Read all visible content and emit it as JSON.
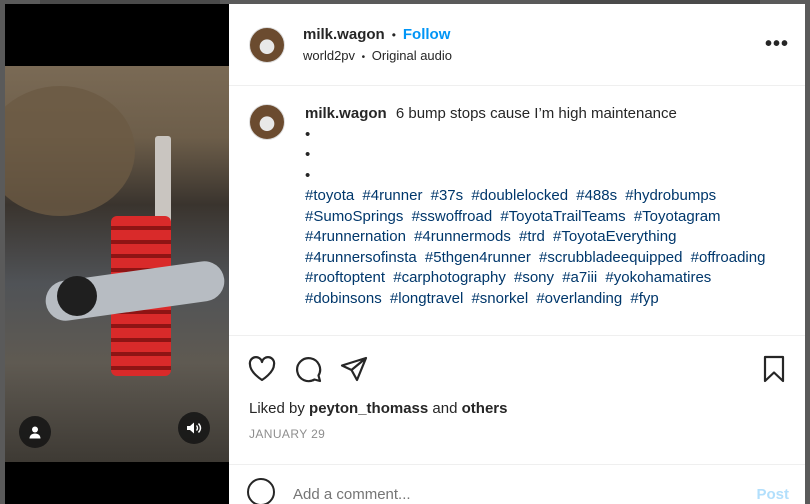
{
  "post": {
    "username": "milk.wagon",
    "separator": "•",
    "follow_label": "Follow",
    "audio_artist": "world2pv",
    "audio_sep": "•",
    "audio_title": "Original audio",
    "more_label": "•••"
  },
  "caption": {
    "username": "milk.wagon",
    "text": "6 bump stops cause I’m high maintenance",
    "bullets": [
      "•",
      "•",
      "•"
    ],
    "hashtags": [
      "#toyota",
      "#4runner",
      "#37s",
      "#doublelocked",
      "#488s",
      "#hydrobumps",
      "#SumoSprings",
      "#sswoffroad",
      "#ToyotaTrailTeams",
      "#Toyotagram",
      "#4runnernation",
      "#4runnermods",
      "#trd",
      "#ToyotaEverything",
      "#4runnersofinsta",
      "#5thgen4runner",
      "#scrubbladeequipped",
      "#offroading",
      "#rooftoptent",
      "#carphotography",
      "#sony",
      "#a7iii",
      "#yokohamatires",
      "#dobinsons",
      "#longtravel",
      "#snorkel",
      "#overlanding",
      "#fyp"
    ]
  },
  "likes": {
    "prefix": "Liked by",
    "user": "peyton_thomass",
    "and": "and",
    "others": "others"
  },
  "date": "JANUARY 29",
  "comment": {
    "placeholder": "Add a comment...",
    "post_label": "Post"
  },
  "icons": {
    "like": "heart-icon",
    "comment": "comment-icon",
    "share": "share-icon",
    "save": "bookmark-icon",
    "emoji": "emoji-icon",
    "user_tag": "user-icon",
    "sound": "speaker-icon"
  },
  "colors": {
    "link": "#0095f6",
    "hashtag": "#00376b",
    "text": "#262626",
    "muted": "#8e8e8e"
  }
}
